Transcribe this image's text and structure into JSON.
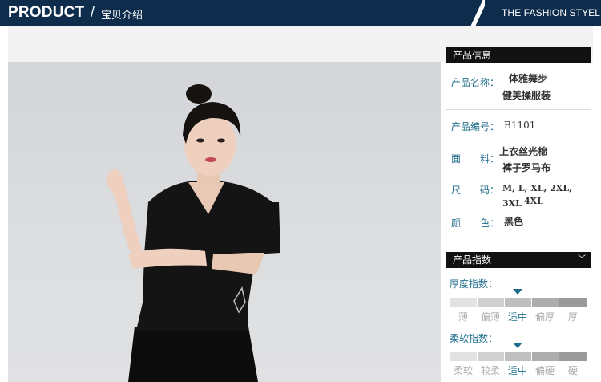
{
  "header": {
    "brand": "PRODUCT",
    "separator": "/",
    "subtitle": "宝贝介绍",
    "tagline": "THE FASHION STYEL"
  },
  "product_info": {
    "title": "产品信息",
    "rows": [
      {
        "label": "产品名称：",
        "value_lines": [
          "体雅舞步",
          "健美操服装"
        ]
      },
      {
        "label": "产品编号：",
        "value_lines": [
          "B1101"
        ]
      },
      {
        "label": "面　　料：",
        "value_lines": [
          "上衣丝光棉",
          "裤子罗马布"
        ]
      },
      {
        "label": "尺　　码：",
        "value_lines": [
          "M, L, XL, 2XL, 3XL",
          "4XL"
        ]
      },
      {
        "label": "颜　　色：",
        "value_lines": [
          "黑色"
        ]
      }
    ]
  },
  "product_indices": {
    "title": "产品指数",
    "scales": [
      {
        "label": "厚度指数：",
        "options": [
          "薄",
          "偏薄",
          "适中",
          "偏厚",
          "厚"
        ],
        "selected_index": 2
      },
      {
        "label": "柔软指数：",
        "options": [
          "柔软",
          "较柔",
          "适中",
          "偏硬",
          "硬"
        ],
        "selected_index": 2
      }
    ],
    "scale_colors": [
      "#e2e2e2",
      "#d0d0d0",
      "#bfbfbf",
      "#adadad",
      "#9a9a9a"
    ]
  },
  "colors": {
    "header_bg": "#0e2d4d",
    "label_color": "#1f6d8c"
  },
  "icons": {
    "dropdown": "chevron-down-icon",
    "indicator": "triangle-down-icon"
  }
}
